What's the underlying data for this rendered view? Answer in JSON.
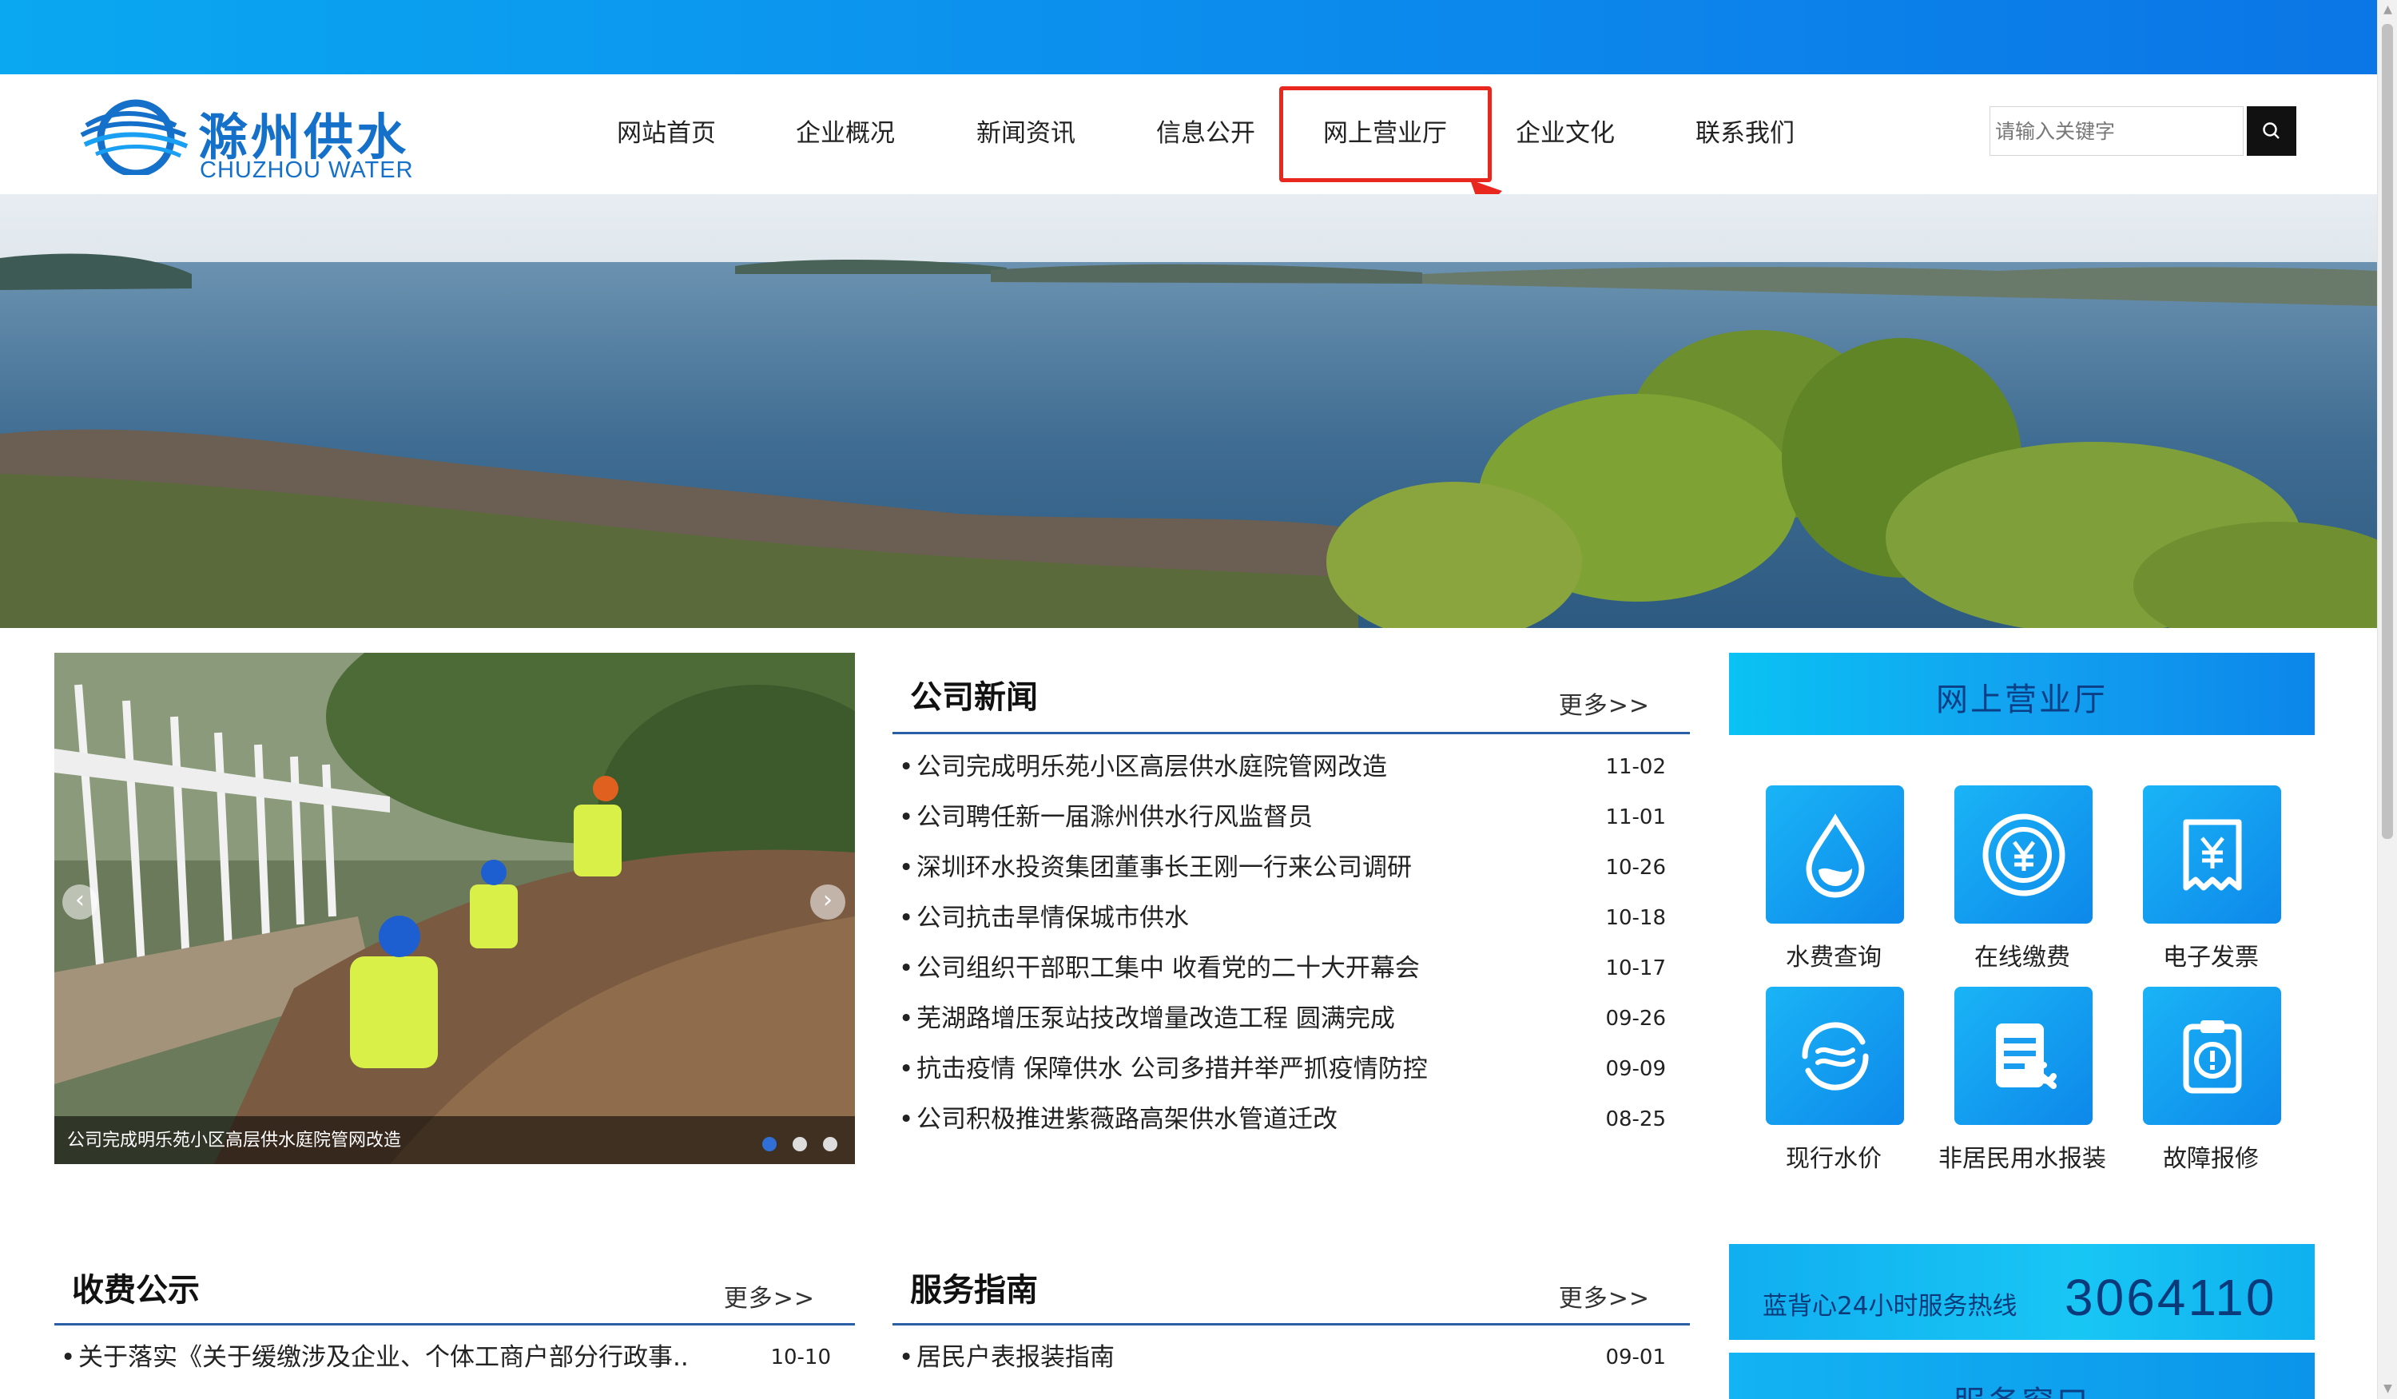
{
  "brand": {
    "name_cn": "滁州供水",
    "name_en": "CHUZHOU WATER"
  },
  "nav": {
    "items": [
      {
        "label": "网站首页"
      },
      {
        "label": "企业概况"
      },
      {
        "label": "新闻资讯"
      },
      {
        "label": "信息公开"
      },
      {
        "label": "网上营业厅",
        "highlighted": true
      },
      {
        "label": "企业文化"
      },
      {
        "label": "联系我们"
      }
    ]
  },
  "search": {
    "placeholder": "请输入关键字",
    "icon": "search-icon"
  },
  "slider": {
    "caption": "公司完成明乐苑小区高层供水庭院管网改造",
    "dot_count": 3,
    "active_dot": 1
  },
  "company_news": {
    "title": "公司新闻",
    "more": "更多>>",
    "items": [
      {
        "title": "公司完成明乐苑小区高层供水庭院管网改造",
        "date": "11-02"
      },
      {
        "title": "公司聘任新一届滁州供水行风监督员",
        "date": "11-01"
      },
      {
        "title": "深圳环水投资集团董事长王刚一行来公司调研",
        "date": "10-26"
      },
      {
        "title": "公司抗击旱情保城市供水",
        "date": "10-18"
      },
      {
        "title": "公司组织干部职工集中 收看党的二十大开幕会",
        "date": "10-17"
      },
      {
        "title": "芜湖路增压泵站技改增量改造工程 圆满完成",
        "date": "09-26"
      },
      {
        "title": "抗击疫情 保障供水 公司多措并举严抓疫情防控",
        "date": "09-09"
      },
      {
        "title": "公司积极推进紫薇路高架供水管道迁改",
        "date": "08-25"
      }
    ]
  },
  "fee_notice": {
    "title": "收费公示",
    "more": "更多>>",
    "items": [
      {
        "title": "关于落实《关于缓缴涉及企业、个体工商户部分行政事..",
        "date": "10-10"
      }
    ]
  },
  "service_guide": {
    "title": "服务指南",
    "more": "更多>>",
    "items": [
      {
        "title": "居民户表报装指南",
        "date": "09-01"
      }
    ]
  },
  "online_hall": {
    "title": "网上营业厅",
    "services": [
      {
        "label": "水费查询",
        "icon": "water-drop-icon"
      },
      {
        "label": "在线缴费",
        "icon": "yen-coin-icon"
      },
      {
        "label": "电子发票",
        "icon": "invoice-icon"
      },
      {
        "label": "现行水价",
        "icon": "water-price-icon"
      },
      {
        "label": "非居民用水报装",
        "icon": "document-wrench-icon"
      },
      {
        "label": "故障报修",
        "icon": "alert-clipboard-icon"
      }
    ]
  },
  "hotline": {
    "label": "蓝背心24小时服务热线",
    "number": "3064110"
  },
  "service_window": {
    "title": "服务窗口"
  },
  "colors": {
    "top_band": "#0c90ee",
    "nav_rule": "#2a5fa8",
    "brand_blue": "#1470c9",
    "highlight_red": "#e8281e",
    "tile_blue": "#1aa0f2"
  }
}
